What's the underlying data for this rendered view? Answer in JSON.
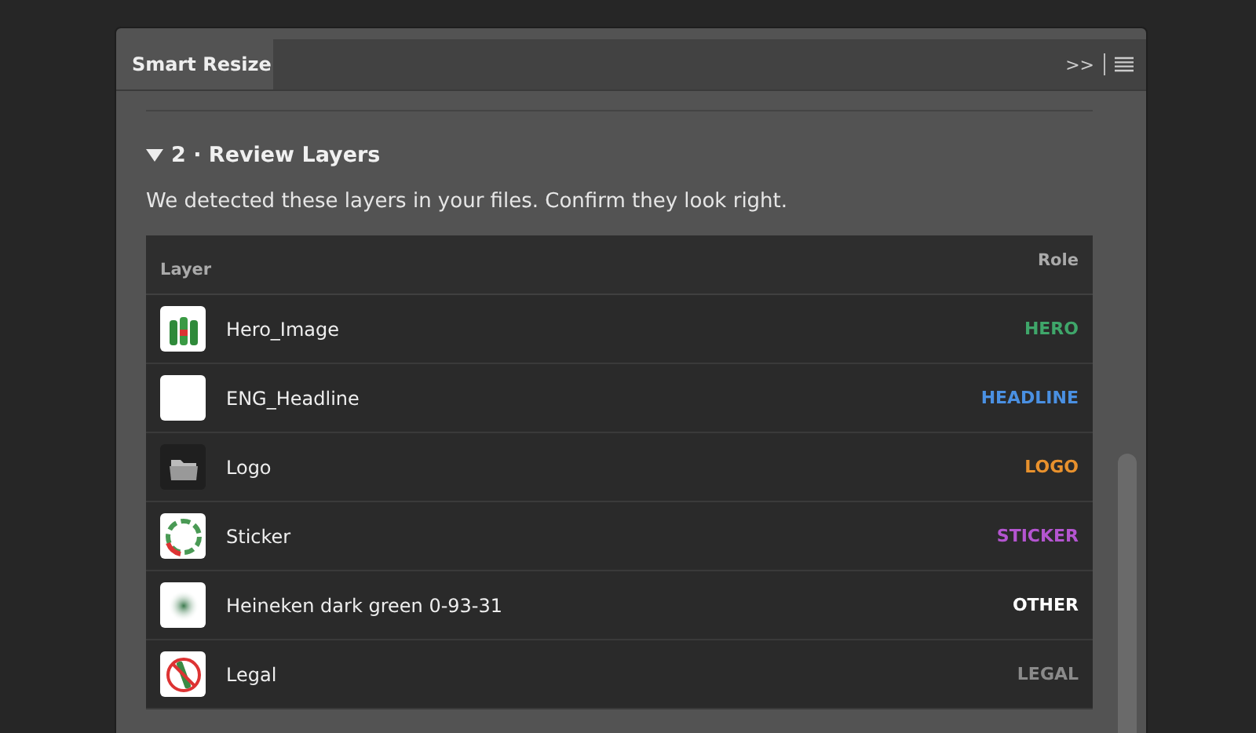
{
  "panel": {
    "tab": "Smart Resize",
    "expand_glyph": ">>"
  },
  "section": {
    "expanded": true,
    "title": "2 · Review Layers",
    "description": "We detected these layers in your files. Confirm they look right."
  },
  "table": {
    "columns": [
      "Layer",
      "Role"
    ],
    "rows": [
      {
        "kind": "photo",
        "name": "Hero_Image",
        "role": "HERO",
        "color": "#3fa66a"
      },
      {
        "kind": "blank",
        "name": "ENG_Headline",
        "role": "HEADLINE",
        "color": "#4a90e2"
      },
      {
        "kind": "folder",
        "name": "Logo",
        "role": "LOGO",
        "color": "#e8912d"
      },
      {
        "kind": "ring",
        "name": "Sticker",
        "role": "STICKER",
        "color": "#b455d0"
      },
      {
        "kind": "blur",
        "name": "Heineken dark green 0-93-31",
        "role": "OTHER",
        "color": "#ffffff"
      },
      {
        "kind": "prohibited",
        "name": "Legal",
        "role": "LEGAL",
        "color": "#8a8a8a"
      }
    ]
  }
}
